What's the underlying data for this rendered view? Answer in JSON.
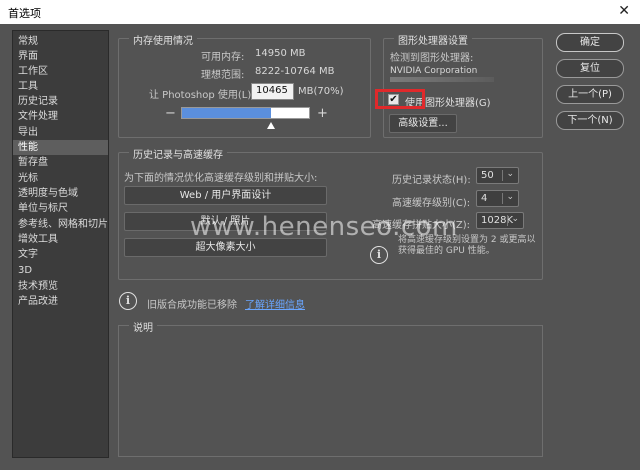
{
  "window": {
    "title": "首选项",
    "close_glyph": "✕"
  },
  "sidebar": {
    "items": [
      {
        "label": "常规",
        "selected": false
      },
      {
        "label": "界面",
        "selected": false
      },
      {
        "label": "工作区",
        "selected": false
      },
      {
        "label": "工具",
        "selected": false
      },
      {
        "label": "历史记录",
        "selected": false
      },
      {
        "label": "文件处理",
        "selected": false
      },
      {
        "label": "导出",
        "selected": false
      },
      {
        "label": "性能",
        "selected": true
      },
      {
        "label": "暂存盘",
        "selected": false
      },
      {
        "label": "光标",
        "selected": false
      },
      {
        "label": "透明度与色域",
        "selected": false
      },
      {
        "label": "单位与标尺",
        "selected": false
      },
      {
        "label": "参考线、网格和切片",
        "selected": false
      },
      {
        "label": "增效工具",
        "selected": false
      },
      {
        "label": "文字",
        "selected": false
      },
      {
        "label": "3D",
        "selected": false
      },
      {
        "label": "技术预览",
        "selected": false
      },
      {
        "label": "产品改进",
        "selected": false
      }
    ]
  },
  "memory": {
    "title": "内存使用情况",
    "available_label": "可用内存:",
    "available_value": "14950 MB",
    "ideal_label": "理想范围:",
    "ideal_value": "8222-10764 MB",
    "let_label": "让 Photoshop 使用(L):",
    "use_value": "10465",
    "use_unit": "MB(70%)",
    "minus": "−",
    "plus": "+",
    "slider_fraction": 0.7
  },
  "gpu": {
    "title": "图形处理器设置",
    "detected_label": "检测到图形处理器:",
    "gpu_name": "NVIDIA Corporation",
    "use_checkbox_label": "使用图形处理器(G)",
    "use_checked": true,
    "check_glyph": "✔",
    "advanced_button": "高级设置..."
  },
  "buttons": {
    "ok": "确定",
    "reset": "复位",
    "prev": "上一个(P)",
    "next": "下一个(N)"
  },
  "history_cache": {
    "title": "历史记录与高速缓存",
    "optimize_label": "为下面的情况优化高速缓存级别和拼贴大小:",
    "preset_web": "Web / 用户界面设计",
    "preset_default": "默认 / 照片",
    "preset_huge": "超大像素大小",
    "history_states_label": "历史记录状态(H):",
    "history_states_value": "50",
    "cache_levels_label": "高速缓存级别(C):",
    "cache_levels_value": "4",
    "tile_size_label": "高速缓存拼贴大小(Z):",
    "tile_size_value": "1028K",
    "hint_text": "将高速缓存级别设置为 2 或更高以获得最佳的 GPU 性能。"
  },
  "legacy": {
    "text": "旧版合成功能已移除",
    "link": "了解详细信息"
  },
  "description": {
    "title": "说明"
  },
  "watermark": "www.henenseo.com",
  "icons": {
    "info": "i",
    "chevron": "⌄"
  },
  "colors": {
    "slider_fill": "#5b8fdd",
    "highlight": "#e0292b",
    "link": "#6aa6ff"
  }
}
